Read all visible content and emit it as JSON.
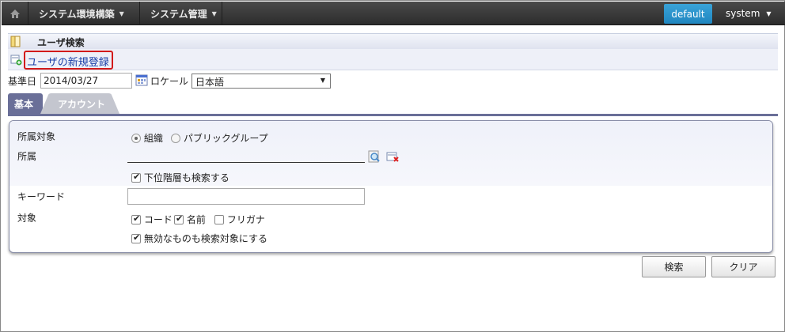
{
  "topbar": {
    "menus": [
      {
        "label": "システム環境構築"
      },
      {
        "label": "システム管理"
      }
    ],
    "env_badge": "default",
    "user": "system"
  },
  "page": {
    "title": "ユーザ検索",
    "new_user_link": "ユーザの新規登録"
  },
  "filters": {
    "date_label": "基準日",
    "date_value": "2014/03/27",
    "locale_label": "ロケール",
    "locale_value": "日本語"
  },
  "tabs": [
    {
      "label": "基本",
      "active": true
    },
    {
      "label": "アカウント",
      "active": false
    }
  ],
  "search_form": {
    "affiliation_target_label": "所属対象",
    "affiliation_options": [
      {
        "label": "組織",
        "selected": true
      },
      {
        "label": "パブリックグループ",
        "selected": false
      }
    ],
    "affiliation_label": "所属",
    "include_lower_label": "下位階層も検索する",
    "include_lower_checked": true,
    "keyword_label": "キーワード",
    "keyword_value": "",
    "target_label": "対象",
    "target_options": [
      {
        "label": "コード",
        "checked": true
      },
      {
        "label": "名前",
        "checked": true
      },
      {
        "label": "フリガナ",
        "checked": false
      }
    ],
    "include_disabled_label": "無効なものも検索対象にする",
    "include_disabled_checked": true
  },
  "buttons": {
    "search": "検索",
    "clear": "クリア"
  },
  "colors": {
    "accent_tab": "#6a6f98",
    "badge": "#2a93cc",
    "highlight_border": "#d21a1a"
  }
}
